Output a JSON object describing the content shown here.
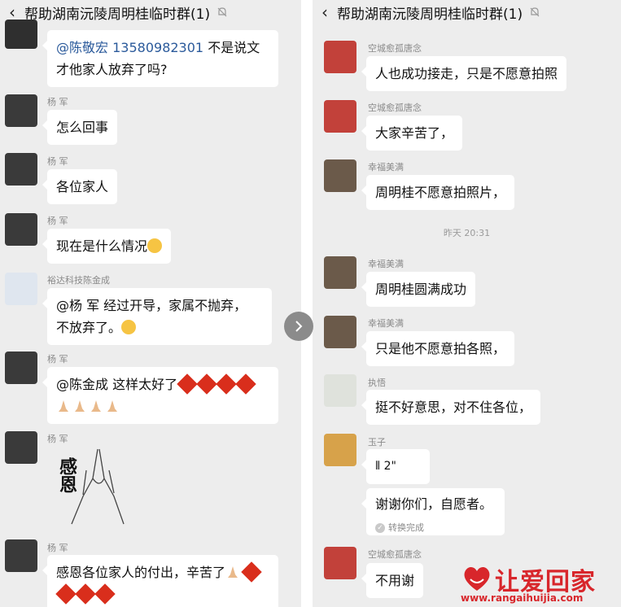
{
  "left": {
    "title": "帮助湖南沅陵周明桂临时群(1)",
    "messages": [
      {
        "sender": "",
        "text_mention": "@陈敬宏",
        "text_phone": "13580982301",
        "text_rest_1": "不是说文",
        "text_rest_2": "才他家人放弃了吗?"
      },
      {
        "sender": "杨  军",
        "text": "怎么回事"
      },
      {
        "sender": "杨  军",
        "text": "各位家人"
      },
      {
        "sender": "杨  军",
        "text": "现在是什么情况"
      },
      {
        "sender": "裕达科技陈金成",
        "line1": "@杨  军  经过开导，家属不抛弃，",
        "line2": "不放弃了。"
      },
      {
        "sender": "杨  军",
        "line1": "@陈金成   这样太好了"
      },
      {
        "sender": "杨  军",
        "sticker_text": "感恩"
      },
      {
        "sender": "杨  军",
        "line1": "感恩各位家人的付出，辛苦了"
      }
    ]
  },
  "right": {
    "title": "帮助湖南沅陵周明桂临时群(1)",
    "messages": [
      {
        "sender": "空城愈孤唐念",
        "text": "人也成功接走，只是不愿意拍照"
      },
      {
        "sender": "空城愈孤唐念",
        "text": "大家辛苦了，"
      },
      {
        "sender": "幸福美满",
        "text": "周明桂不愿意拍照片，"
      },
      {
        "sender": "幸福美满",
        "text": "周明桂圆满成功"
      },
      {
        "sender": "幸福美满",
        "text": "只是他不愿意拍各照，"
      },
      {
        "sender": "执悟",
        "text": "挺不好意思，对不住各位，"
      },
      {
        "sender": "玉子",
        "voice": "2\"",
        "text": "谢谢你们，自愿者。",
        "status": "转换完成"
      },
      {
        "sender": "空城愈孤唐念",
        "text": "不用谢"
      }
    ],
    "time_separator": "昨天 20:31"
  },
  "watermark": {
    "title": "让爱回家",
    "url": "www.rangaihuijia.com"
  },
  "icons": {
    "back": "back-chevron-icon",
    "mute": "mute-bell-icon",
    "next": "next-arrow-icon"
  }
}
